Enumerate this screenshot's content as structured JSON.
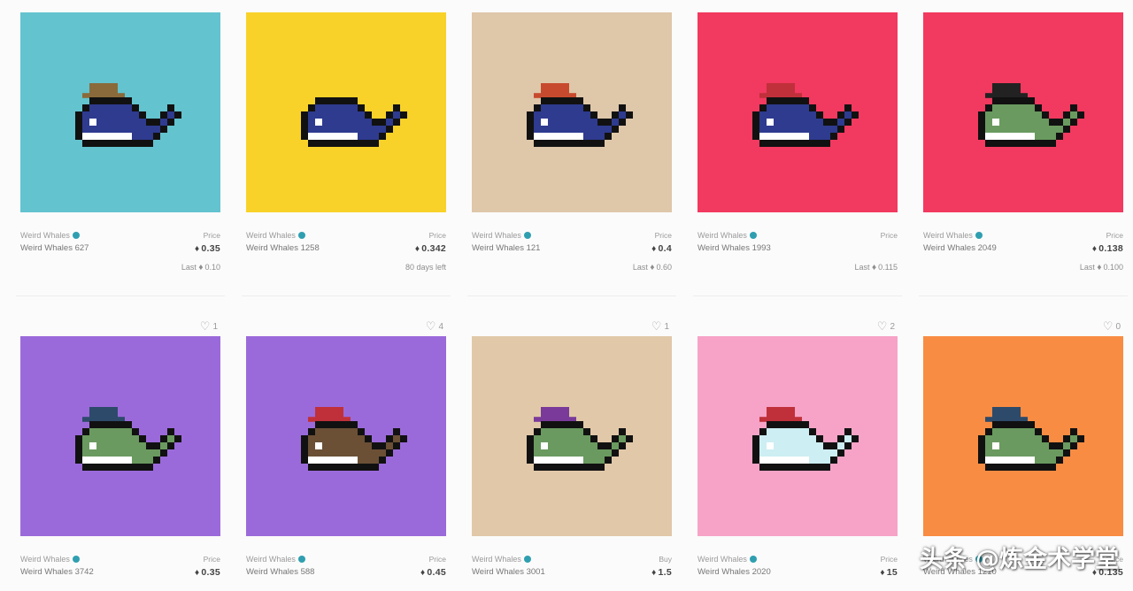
{
  "cards": [
    {
      "bg": "#63c3cf",
      "collection": "Weird Whales",
      "name": "Weird Whales 627",
      "price_label": "Price",
      "price": "0.35",
      "last_label": "Last",
      "last": "0.10",
      "likes": "1",
      "whale": "#2e3b8f",
      "hat": "#8a6a3a"
    },
    {
      "bg": "#f9d229",
      "collection": "Weird Whales",
      "name": "Weird Whales 1258",
      "price_label": "Price",
      "price": "0.342",
      "last_text": "80 days left",
      "likes": "4",
      "whale": "#2e3b8f",
      "hat": ""
    },
    {
      "bg": "#dfc7a9",
      "collection": "Weird Whales",
      "name": "Weird Whales 121",
      "price_label": "Price",
      "price": "0.4",
      "last_label": "Last",
      "last": "0.60",
      "likes": "1",
      "whale": "#2e3b8f",
      "hat": "#c84a2e"
    },
    {
      "bg": "#f2395f",
      "collection": "Weird Whales",
      "name": "Weird Whales 1993",
      "price_label": "Price",
      "price": "",
      "last_label": "Last",
      "last": "0.115",
      "likes": "2",
      "whale": "#2e3b8f",
      "hat": "#c0303a"
    },
    {
      "bg": "#f2395f",
      "collection": "Weird Whales",
      "name": "Weird Whales 2049",
      "price_label": "Price",
      "price": "0.138",
      "last_label": "Last",
      "last": "0.100",
      "likes": "0",
      "whale": "#6a9a5f",
      "hat": "#222222"
    },
    {
      "bg": "#9b6ada",
      "collection": "Weird Whales",
      "name": "Weird Whales 3742",
      "price_label": "Price",
      "price": "0.35",
      "whale": "#6a9a5f",
      "hat": "#2d4a6a"
    },
    {
      "bg": "#9b6ada",
      "collection": "Weird Whales",
      "name": "Weird Whales 588",
      "price_label": "Price",
      "price": "0.45",
      "whale": "#6b5036",
      "hat": "#c0303a"
    },
    {
      "bg": "#e1c8a8",
      "collection": "Weird Whales",
      "name": "Weird Whales 3001",
      "price_label": "Buy",
      "price": "1.5",
      "whale": "#6a9a5f",
      "hat": "#7a3a9a"
    },
    {
      "bg": "#f7a3c7",
      "collection": "Weird Whales",
      "name": "Weird Whales 2020",
      "price_label": "Price",
      "price": "15",
      "whale": "#cdeef2",
      "hat": "#c0303a"
    },
    {
      "bg": "#f98c43",
      "collection": "Weird Whales",
      "name": "Weird Whales 1210",
      "price_label": "Price",
      "price": "0.135",
      "whale": "#6a9a5f",
      "hat": "#2d4a6a"
    }
  ],
  "watermark": "头条 @炼金术学堂"
}
